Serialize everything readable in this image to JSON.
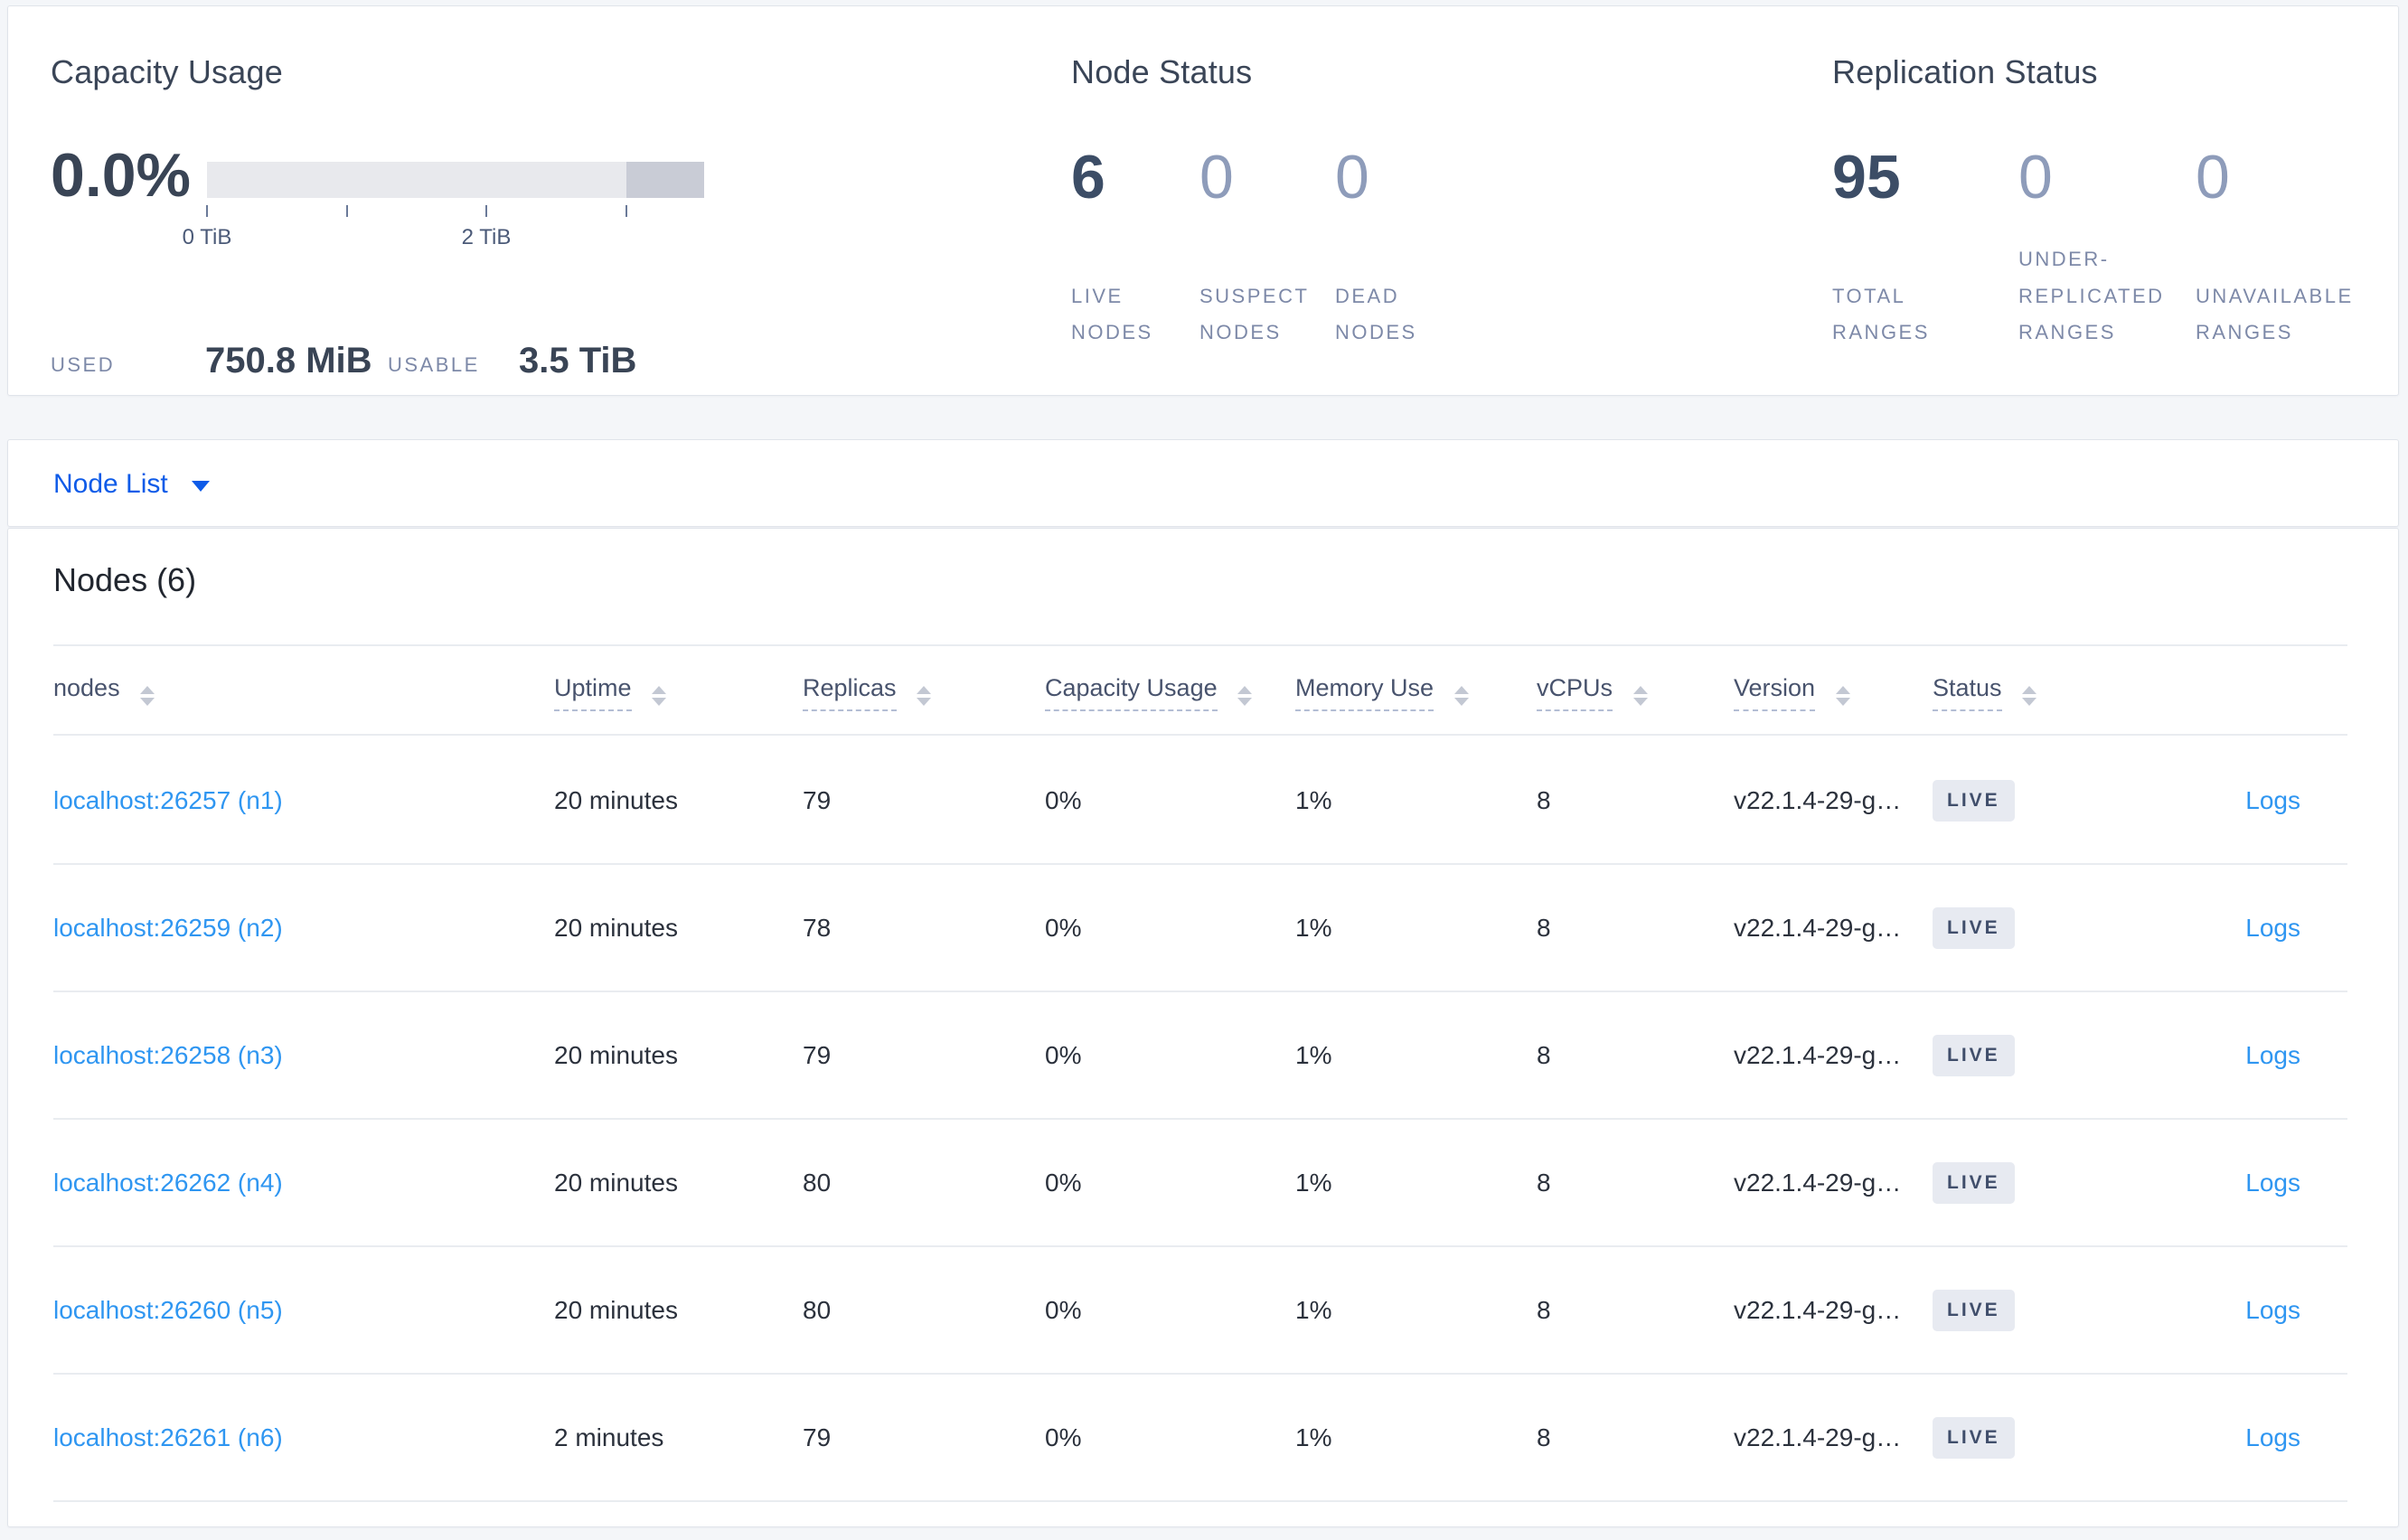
{
  "capacity_panel": {
    "title": "Capacity Usage",
    "percent": "0.0%",
    "ticks": {
      "t0": "0 TiB",
      "t2": "2 TiB"
    },
    "used_label": "USED",
    "used_value": "750.8 MiB",
    "usable_label": "USABLE",
    "usable_value": "3.5 TiB"
  },
  "node_status_panel": {
    "title": "Node Status",
    "stats": [
      {
        "value": "6",
        "label": "LIVE NODES"
      },
      {
        "value": "0",
        "label": "SUSPECT NODES"
      },
      {
        "value": "0",
        "label": "DEAD NODES"
      }
    ]
  },
  "replication_panel": {
    "title": "Replication Status",
    "stats": [
      {
        "value": "95",
        "label": "TOTAL RANGES"
      },
      {
        "value": "0",
        "label": "UNDER-REPLICATED RANGES"
      },
      {
        "value": "0",
        "label": "UNAVAILABLE RANGES"
      }
    ]
  },
  "node_list_bar": {
    "label": "Node List"
  },
  "nodes_table": {
    "title": "Nodes (6)",
    "columns": {
      "nodes": "nodes",
      "uptime": "Uptime",
      "replicas": "Replicas",
      "capacity": "Capacity Usage",
      "memory": "Memory Use",
      "vcpus": "vCPUs",
      "version": "Version",
      "status": "Status"
    },
    "logs_label": "Logs",
    "rows": [
      {
        "node": "localhost:26257 (n1)",
        "uptime": "20 minutes",
        "replicas": "79",
        "capacity": "0%",
        "memory": "1%",
        "vcpus": "8",
        "version": "v22.1.4-29-g…",
        "status": "LIVE"
      },
      {
        "node": "localhost:26259 (n2)",
        "uptime": "20 minutes",
        "replicas": "78",
        "capacity": "0%",
        "memory": "1%",
        "vcpus": "8",
        "version": "v22.1.4-29-g…",
        "status": "LIVE"
      },
      {
        "node": "localhost:26258 (n3)",
        "uptime": "20 minutes",
        "replicas": "79",
        "capacity": "0%",
        "memory": "1%",
        "vcpus": "8",
        "version": "v22.1.4-29-g…",
        "status": "LIVE"
      },
      {
        "node": "localhost:26262 (n4)",
        "uptime": "20 minutes",
        "replicas": "80",
        "capacity": "0%",
        "memory": "1%",
        "vcpus": "8",
        "version": "v22.1.4-29-g…",
        "status": "LIVE"
      },
      {
        "node": "localhost:26260 (n5)",
        "uptime": "20 minutes",
        "replicas": "80",
        "capacity": "0%",
        "memory": "1%",
        "vcpus": "8",
        "version": "v22.1.4-29-g…",
        "status": "LIVE"
      },
      {
        "node": "localhost:26261 (n6)",
        "uptime": "2 minutes",
        "replicas": "79",
        "capacity": "0%",
        "memory": "1%",
        "vcpus": "8",
        "version": "v22.1.4-29-g…",
        "status": "LIVE"
      }
    ]
  },
  "colors": {
    "accent_blue": "#0e5be8",
    "link_blue": "#2f96f1",
    "dark_slate": "#394455",
    "dim_stat": "#8e9cba",
    "badge_bg": "#e7eaf1"
  }
}
